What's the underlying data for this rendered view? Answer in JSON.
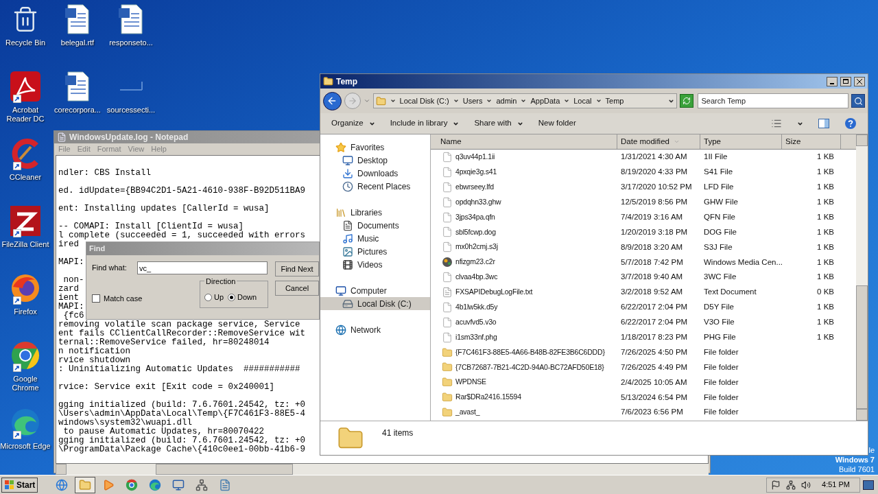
{
  "desktop_icons": [
    [
      {
        "label": "Recycle Bin",
        "kind": "recycle",
        "shortcut": false
      },
      {
        "label": "Acrobat Reader DC",
        "kind": "acrobat",
        "shortcut": true
      },
      {
        "label": "CCleaner",
        "kind": "ccleaner",
        "shortcut": true
      },
      {
        "label": "FileZilla Client",
        "kind": "filezilla",
        "shortcut": true
      },
      {
        "label": "Firefox",
        "kind": "firefox",
        "shortcut": true
      },
      {
        "label": "Google Chrome",
        "kind": "chrome",
        "shortcut": true
      },
      {
        "label": "Microsoft Edge",
        "kind": "edge",
        "shortcut": true
      }
    ],
    [
      {
        "label": "belegal.rtf",
        "kind": "document",
        "shortcut": false
      },
      {
        "label": "corecorpora...",
        "kind": "document",
        "shortcut": false
      }
    ],
    [
      {
        "label": "responseto...",
        "kind": "document",
        "shortcut": false
      },
      {
        "label": "sourcessecti...",
        "kind": "blank",
        "shortcut": false
      }
    ]
  ],
  "desktop_watermark": [
    "le",
    "Windows 7",
    "Build 7601"
  ],
  "notepad": {
    "title": "WindowsUpdate.log - Notepad",
    "menu": [
      "File",
      "Edit",
      "Format",
      "View",
      "Help"
    ],
    "blocks": [
      [
        "ndler: CBS Install"
      ],
      [
        "ed. idUpdate={BB94C2D1-5A21-4610-938F-B92D511BA9"
      ],
      [
        "ent: Installing updates [CallerId = wusa]"
      ],
      [
        "-- COMAPI: Install [ClientId = wusa]",
        "l complete (succeeded = 1, succeeded with errors",
        "ired"
      ],
      [
        "MAPI:"
      ],
      [
        " non-",
        "zard",
        "ient",
        "MAPI:",
        " {fc6",
        "removing volatile scan package service, Service",
        "ent fails CClientCallRecorder::RemoveService wit",
        "ternal::RemoveService failed, hr=80248014",
        "n notification",
        "rvice shutdown",
        ": Uninitializing Automatic Updates  ###########"
      ],
      [
        "rvice: Service exit [Exit code = 0x240001]"
      ],
      [
        "gging initialized (build: 7.6.7601.24542, tz: +0",
        "\\Users\\admin\\AppData\\Local\\Temp\\{F7C461F3-88E5-4",
        "windows\\system32\\wuapi.dll",
        " to pause Automatic Updates, hr=80070422",
        "gging initialized (build: 7.6.7601.24542, tz: +0",
        "\\ProgramData\\Package Cache\\{410c0ee1-00bb-41b6-9"
      ]
    ]
  },
  "find_dialog": {
    "title": "Find",
    "find_what_label": "Find what:",
    "value": "vc_",
    "match_case": {
      "label": "Match case",
      "checked": false
    },
    "direction": {
      "label": "Direction",
      "options": [
        {
          "label": "Up",
          "selected": false
        },
        {
          "label": "Down",
          "selected": true
        }
      ]
    },
    "buttons": [
      "Find Next",
      "Cancel"
    ]
  },
  "explorer": {
    "title": "Temp",
    "breadcrumbs": [
      "Local Disk (C:)",
      "Users",
      "admin",
      "AppData",
      "Local",
      "Temp"
    ],
    "search": {
      "placeholder": "Search Temp"
    },
    "toolbar": [
      {
        "label": "Organize",
        "dropdown": true
      },
      {
        "label": "Include in library",
        "dropdown": true
      },
      {
        "label": "Share with",
        "dropdown": true
      },
      {
        "label": "New folder",
        "dropdown": false
      }
    ],
    "nav": [
      {
        "label": "Favorites",
        "kind": "star",
        "selected": false,
        "children": [
          {
            "label": "Desktop",
            "kind": "desktop",
            "selected": false
          },
          {
            "label": "Downloads",
            "kind": "downloads",
            "selected": false
          },
          {
            "label": "Recent Places",
            "kind": "recent",
            "selected": false
          }
        ]
      },
      {
        "label": "Libraries",
        "kind": "library",
        "selected": false,
        "children": [
          {
            "label": "Documents",
            "kind": "documents",
            "selected": false
          },
          {
            "label": "Music",
            "kind": "music",
            "selected": false
          },
          {
            "label": "Pictures",
            "kind": "pictures",
            "selected": false
          },
          {
            "label": "Videos",
            "kind": "videos",
            "selected": false
          }
        ]
      },
      {
        "label": "Computer",
        "kind": "computer",
        "selected": false,
        "children": [
          {
            "label": "Local Disk (C:)",
            "kind": "disk",
            "selected": true
          }
        ]
      },
      {
        "label": "Network",
        "kind": "network",
        "selected": false
      }
    ],
    "columns": [
      {
        "label": "Name",
        "sorted": false
      },
      {
        "label": "Date modified",
        "sorted": true
      },
      {
        "label": "Type",
        "sorted": false
      },
      {
        "label": "Size",
        "sorted": false
      }
    ],
    "rows": [
      {
        "name": "q3uv44p1.1ii",
        "date": "1/31/2021 4:30 AM",
        "type": "1II File",
        "size": "1 KB",
        "kind": "file"
      },
      {
        "name": "4pxqie3g.s41",
        "date": "8/19/2020 4:33 PM",
        "type": "S41 File",
        "size": "1 KB",
        "kind": "file"
      },
      {
        "name": "ebwrseey.lfd",
        "date": "3/17/2020 10:52 PM",
        "type": "LFD File",
        "size": "1 KB",
        "kind": "file"
      },
      {
        "name": "opdqhn33.ghw",
        "date": "12/5/2019 8:56 PM",
        "type": "GHW File",
        "size": "1 KB",
        "kind": "file"
      },
      {
        "name": "3jps34pa.qfn",
        "date": "7/4/2019 3:16 AM",
        "type": "QFN File",
        "size": "1 KB",
        "kind": "file"
      },
      {
        "name": "sbl5fcwp.dog",
        "date": "1/20/2019 3:18 PM",
        "type": "DOG File",
        "size": "1 KB",
        "kind": "file"
      },
      {
        "name": "mx0h2cmj.s3j",
        "date": "8/9/2018 3:20 AM",
        "type": "S3J File",
        "size": "1 KB",
        "kind": "file"
      },
      {
        "name": "nfizgm23.c2r",
        "date": "5/7/2018 7:42 PM",
        "type": "Windows Media Cen...",
        "size": "1 KB",
        "kind": "media"
      },
      {
        "name": "clvaa4bp.3wc",
        "date": "3/7/2018 9:40 AM",
        "type": "3WC File",
        "size": "1 KB",
        "kind": "file"
      },
      {
        "name": "FXSAPIDebugLogFile.txt",
        "date": "3/2/2018 9:52 AM",
        "type": "Text Document",
        "size": "0 KB",
        "kind": "text"
      },
      {
        "name": "4b1lw5kk.d5y",
        "date": "6/22/2017 2:04 PM",
        "type": "D5Y File",
        "size": "1 KB",
        "kind": "file"
      },
      {
        "name": "acuvfvd5.v3o",
        "date": "6/22/2017 2:04 PM",
        "type": "V3O File",
        "size": "1 KB",
        "kind": "file"
      },
      {
        "name": "i1sm33nf.phg",
        "date": "1/18/2017 8:23 PM",
        "type": "PHG File",
        "size": "1 KB",
        "kind": "file"
      },
      {
        "name": "{F7C461F3-88E5-4A66-B48B-82FE3B6C6DDD}",
        "date": "7/26/2025 4:50 PM",
        "type": "File folder",
        "kind": "folder"
      },
      {
        "name": "{7CB72687-7B21-4C2D-94A0-BC72AFD50E18}",
        "date": "7/26/2025 4:49 PM",
        "type": "File folder",
        "kind": "folder"
      },
      {
        "name": "WPDNSE",
        "date": "2/4/2025 10:05 AM",
        "type": "File folder",
        "kind": "folder"
      },
      {
        "name": "Rar$DRa2416.15594",
        "date": "5/13/2024 6:54 PM",
        "type": "File folder",
        "kind": "folder"
      },
      {
        "name": "_avast_",
        "date": "7/6/2023 6:56 PM",
        "type": "File folder",
        "kind": "folder"
      }
    ],
    "status": "41 items"
  },
  "taskbar": {
    "start": "Start",
    "apps": [
      {
        "kind": "ie",
        "active": false
      },
      {
        "kind": "explorer",
        "active": true
      },
      {
        "kind": "media",
        "active": false
      },
      {
        "kind": "chrome",
        "active": false
      },
      {
        "kind": "edge",
        "active": false
      },
      {
        "kind": "remote",
        "active": false
      },
      {
        "kind": "tool",
        "active": false
      },
      {
        "kind": "notepad",
        "active": false
      }
    ],
    "clock": "4:51 PM"
  }
}
